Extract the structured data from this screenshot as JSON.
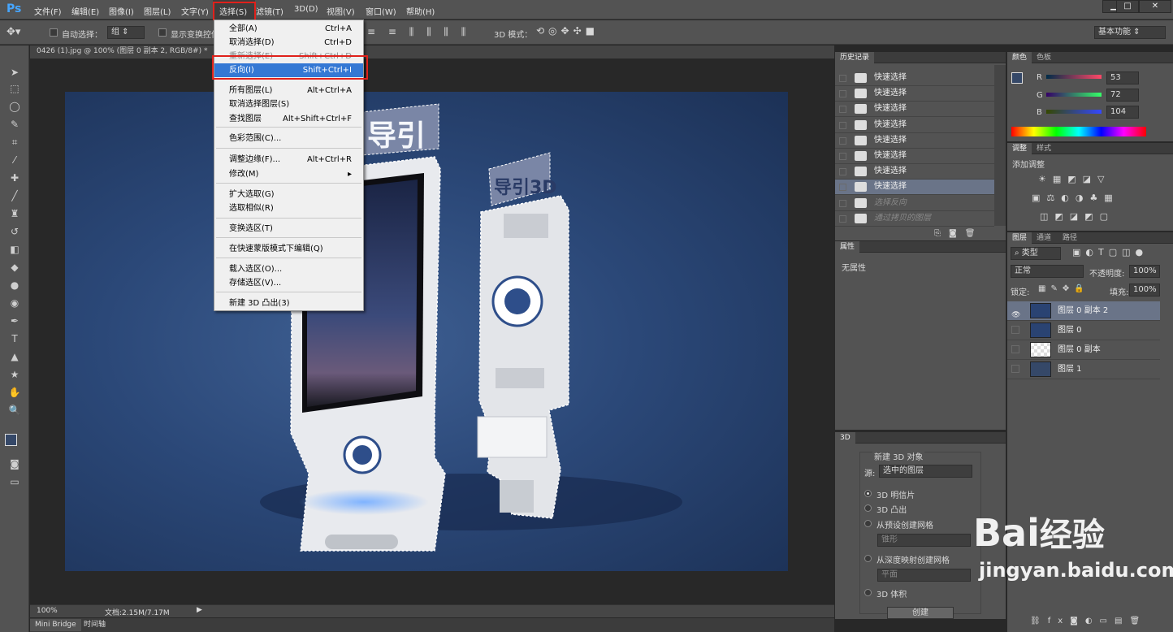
{
  "app": {
    "logo": "Ps"
  },
  "menubar": {
    "items": [
      "文件(F)",
      "编辑(E)",
      "图像(I)",
      "图层(L)",
      "文字(Y)",
      "选择(S)",
      "滤镜(T)",
      "3D(D)",
      "视图(V)",
      "窗口(W)",
      "帮助(H)"
    ],
    "window_buttons": [
      "▁",
      "□",
      "✕"
    ]
  },
  "options": {
    "auto_select_label": "自动选择：",
    "auto_select_value": "组",
    "show_transform": "显示变换控件",
    "mode_3d": "3D 模式：",
    "workspace": "基本功能"
  },
  "document": {
    "tab_title": "0426 (1).jpg @ 100% (图层 0 副本 2, RGB/8#) *",
    "zoom": "100%",
    "doc_size": "文档:2.15M/7.17M",
    "product_sign_front": "导引",
    "product_sign_back": "导引3D"
  },
  "bottom_tabs": [
    "Mini Bridge",
    "时间轴"
  ],
  "select_menu": {
    "items": [
      {
        "label": "全部(A)",
        "shortcut": "Ctrl+A",
        "state": "normal"
      },
      {
        "label": "取消选择(D)",
        "shortcut": "Ctrl+D",
        "state": "normal"
      },
      {
        "label": "重新选择(E)",
        "shortcut": "Shift+Ctrl+D",
        "state": "dim"
      },
      {
        "label": "反向(I)",
        "shortcut": "Shift+Ctrl+I",
        "state": "highlight"
      },
      {
        "label": "所有图层(L)",
        "shortcut": "Alt+Ctrl+A",
        "state": "normal"
      },
      {
        "label": "取消选择图层(S)",
        "shortcut": "",
        "state": "normal"
      },
      {
        "label": "查找图层",
        "shortcut": "Alt+Shift+Ctrl+F",
        "state": "normal"
      },
      {
        "label": "色彩范围(C)...",
        "shortcut": "",
        "state": "normal"
      },
      {
        "label": "调整边缘(F)...",
        "shortcut": "Alt+Ctrl+R",
        "state": "normal"
      },
      {
        "label": "修改(M)",
        "shortcut": "▸",
        "state": "normal"
      },
      {
        "label": "扩大选取(G)",
        "shortcut": "",
        "state": "normal"
      },
      {
        "label": "选取相似(R)",
        "shortcut": "",
        "state": "normal"
      },
      {
        "label": "变换选区(T)",
        "shortcut": "",
        "state": "normal"
      },
      {
        "label": "在快速蒙版模式下编辑(Q)",
        "shortcut": "",
        "state": "normal"
      },
      {
        "label": "载入选区(O)...",
        "shortcut": "",
        "state": "normal"
      },
      {
        "label": "存储选区(V)...",
        "shortcut": "",
        "state": "normal"
      },
      {
        "label": "新建 3D 凸出(3)",
        "shortcut": "",
        "state": "normal"
      }
    ]
  },
  "history": {
    "title": "历史记录",
    "items": [
      {
        "label": "快速选择",
        "dim": false
      },
      {
        "label": "快速选择",
        "dim": false
      },
      {
        "label": "快速选择",
        "dim": false
      },
      {
        "label": "快速选择",
        "dim": false
      },
      {
        "label": "快速选择",
        "dim": false
      },
      {
        "label": "快速选择",
        "dim": false
      },
      {
        "label": "快速选择",
        "dim": false
      },
      {
        "label": "快速选择",
        "dim": false
      },
      {
        "label": "选择反向",
        "dim": true
      },
      {
        "label": "通过拷贝的图层",
        "dim": true
      }
    ]
  },
  "properties": {
    "title": "属性",
    "empty": "无属性"
  },
  "panel3d": {
    "title": "3D",
    "new_obj": "新建 3D 对象",
    "source_label": "源:",
    "source_value": "选中的图层",
    "options": [
      "3D 明信片",
      "3D 凸出",
      "从预设创建网格",
      "从深度映射创建网格",
      "3D 体积"
    ],
    "preset_value": "锥形",
    "depth_value": "平面",
    "create": "创建"
  },
  "color": {
    "tabs": [
      "颜色",
      "色板"
    ],
    "r": "53",
    "g": "72",
    "b": "104",
    "fg": "#354868"
  },
  "adjust": {
    "tabs": [
      "调整",
      "样式"
    ],
    "add": "添加调整"
  },
  "layers": {
    "tabs": [
      "图层",
      "通道",
      "路径"
    ],
    "kind": "类型",
    "blend": "正常",
    "opacity_label": "不透明度:",
    "opacity": "100%",
    "lock_label": "锁定:",
    "fill_label": "填充:",
    "fill": "100%",
    "items": [
      {
        "name": "图层 0 副本 2",
        "visible": true,
        "active": true
      },
      {
        "name": "图层 0",
        "visible": false,
        "active": false
      },
      {
        "name": "图层 0 副本",
        "visible": false,
        "active": false
      },
      {
        "name": "图层 1",
        "visible": false,
        "active": false
      }
    ]
  },
  "watermark": {
    "brand": "Bai",
    "brand_suffix": "经验",
    "url": "jingyan.baidu.com"
  }
}
